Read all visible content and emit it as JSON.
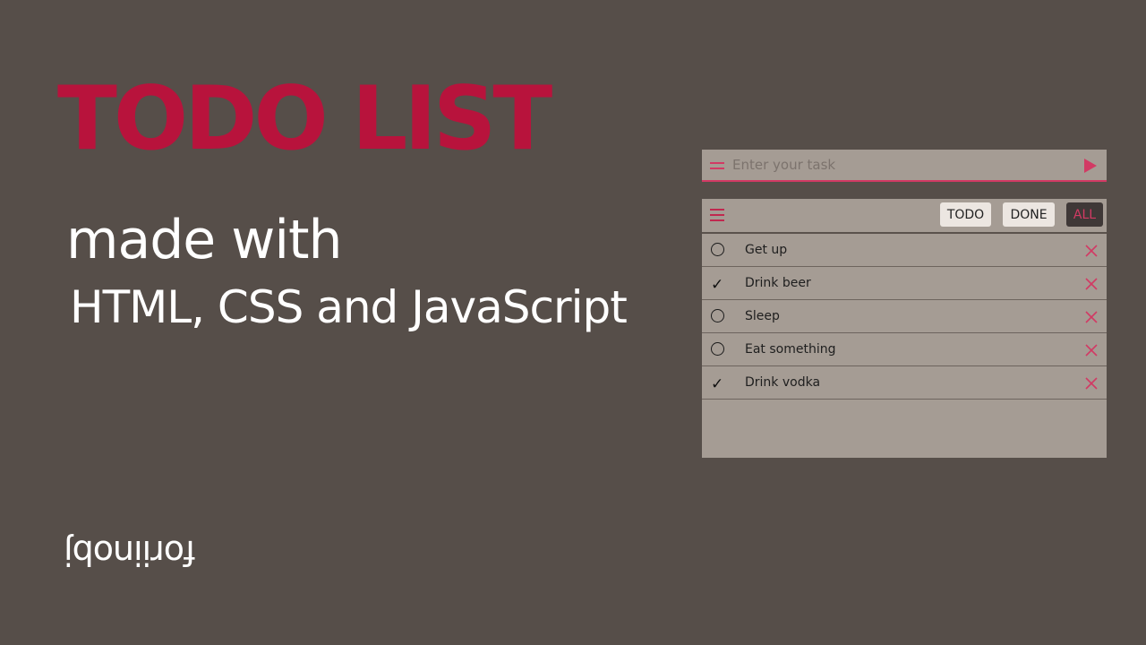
{
  "hero": {
    "title": "TODO LIST",
    "subtitle_line1": "made with",
    "subtitle_line2": "HTML, CSS and JavaScript",
    "signature": "foriinobj"
  },
  "colors": {
    "background": "#564e49",
    "accent": "#d23a64",
    "title": "#b8133c",
    "panel": "#a59c94"
  },
  "input": {
    "placeholder": "Enter your task",
    "value": "",
    "menu_icon": "equals-icon",
    "submit_icon": "play-arrow-icon"
  },
  "filters": {
    "menu_icon": "hamburger-icon",
    "todo_label": "TODO",
    "done_label": "DONE",
    "all_label": "ALL",
    "active": "ALL"
  },
  "tasks": [
    {
      "text": "Get up",
      "done": false
    },
    {
      "text": "Drink beer",
      "done": true
    },
    {
      "text": "Sleep",
      "done": false
    },
    {
      "text": "Eat something",
      "done": false
    },
    {
      "text": "Drink vodka",
      "done": true
    }
  ]
}
